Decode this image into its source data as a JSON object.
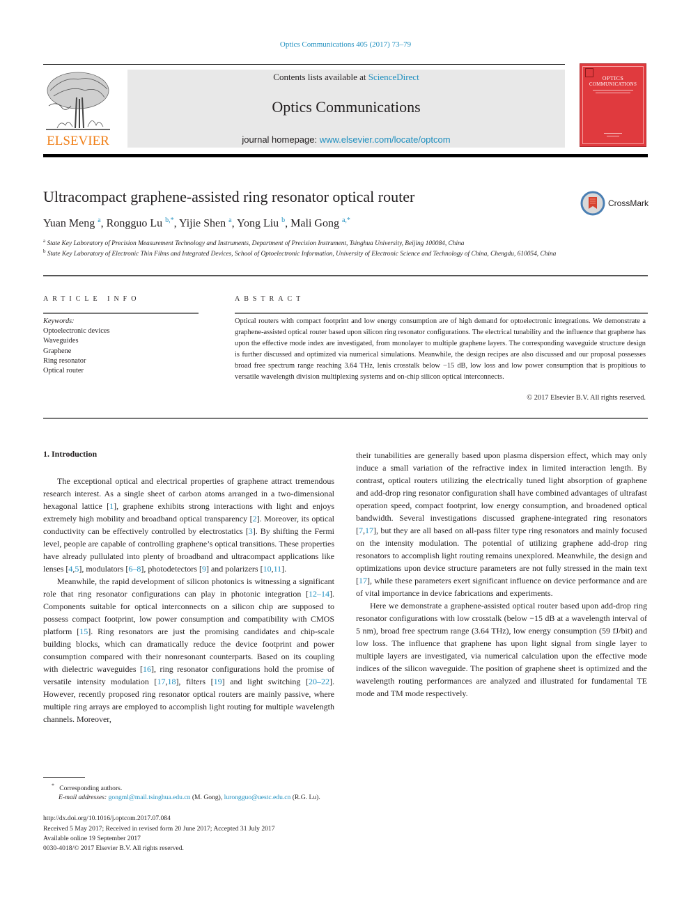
{
  "header": {
    "journal_ref": "Optics Communications 405 (2017) 73–79",
    "contents_prefix": "Contents lists available at ",
    "contents_link": "ScienceDirect",
    "journal_name": "Optics Communications",
    "homepage_prefix": "journal homepage: ",
    "homepage_link": "www.elsevier.com/locate/optcom",
    "publisher_logo_text": "ELSEVIER",
    "cover_title_line1": "OPTICS",
    "cover_title_line2": "COMMUNICATIONS"
  },
  "colors": {
    "link": "#1f8fbf",
    "elsevier_orange": "#f07f17",
    "cover_red": "#e03a3e",
    "masthead_gray": "#e8e8e8",
    "text": "#231f20"
  },
  "article": {
    "title": "Ultracompact graphene-assisted ring resonator optical router",
    "crossmark_label": "CrossMark",
    "authors": [
      {
        "name": "Yuan Meng",
        "sup": "a"
      },
      {
        "name": "Rongguo Lu",
        "sup": "b,*"
      },
      {
        "name": "Yijie Shen",
        "sup": "a"
      },
      {
        "name": "Yong Liu",
        "sup": "b"
      },
      {
        "name": "Mali Gong",
        "sup": "a,*"
      }
    ],
    "affiliations": [
      {
        "key": "a",
        "text": "State Key Laboratory of Precision Measurement Technology and Instruments, Department of Precision Instrument, Tsinghua University, Beijing 100084, China"
      },
      {
        "key": "b",
        "text": "State Key Laboratory of Electronic Thin Films and Integrated Devices, School of Optoelectronic Information, University of Electronic Science and Technology of China, Chengdu, 610054, China"
      }
    ]
  },
  "article_info": {
    "heading": "ARTICLE INFO",
    "keywords_label": "Keywords:",
    "keywords": [
      "Optoelectronic devices",
      "Waveguides",
      "Graphene",
      "Ring resonator",
      "Optical router"
    ]
  },
  "abstract": {
    "heading": "ABSTRACT",
    "text": "Optical routers with compact footprint and low energy consumption are of high demand for optoelectronic integrations. We demonstrate a graphene-assisted optical router based upon silicon ring resonator configurations. The electrical tunability and the influence that graphene has upon the effective mode index are investigated, from monolayer to multiple graphene layers. The corresponding waveguide structure design is further discussed and optimized via numerical simulations. Meanwhile, the design recipes are also discussed and our proposal possesses broad free spectrum range reaching 3.64 THz, lenis crosstalk below −15 dB, low loss and low power consumption that is propitious to versatile wavelength division multiplexing systems and on-chip silicon optical interconnects.",
    "copyright": "© 2017 Elsevier B.V. All rights reserved."
  },
  "body": {
    "section_heading": "1.  Introduction",
    "left_paragraphs": [
      [
        {
          "t": "The exceptional optical and electrical properties of graphene attract tremendous research interest. As a single sheet of carbon atoms arranged in a two-dimensional hexagonal lattice ["
        },
        {
          "c": "1"
        },
        {
          "t": "], graphene exhibits strong interactions with light and enjoys extremely high mobility and broadband optical transparency ["
        },
        {
          "c": "2"
        },
        {
          "t": "]. Moreover, its optical conductivity can be effectively controlled by electrostatics ["
        },
        {
          "c": "3"
        },
        {
          "t": "]. By shifting the Fermi level, people are capable of controlling graphene’s optical transitions. These properties have already pullulated into plenty of broadband and ultracompact applications like lenses ["
        },
        {
          "c": "4"
        },
        {
          "t": ","
        },
        {
          "c": "5"
        },
        {
          "t": "], modulators ["
        },
        {
          "c": "6–8"
        },
        {
          "t": "], photodetectors ["
        },
        {
          "c": "9"
        },
        {
          "t": "] and polarizers ["
        },
        {
          "c": "10"
        },
        {
          "t": ","
        },
        {
          "c": "11"
        },
        {
          "t": "]."
        }
      ],
      [
        {
          "t": "Meanwhile, the rapid development of silicon photonics is witnessing a significant role that ring resonator configurations can play in photonic integration ["
        },
        {
          "c": "12–14"
        },
        {
          "t": "]. Components suitable for optical interconnects on a silicon chip are supposed to possess compact footprint, low power consumption and compatibility with CMOS platform ["
        },
        {
          "c": "15"
        },
        {
          "t": "]. Ring resonators are just the promising candidates and chip-scale building blocks, which can dramatically reduce the device footprint and power consumption compared with their nonresonant counterparts. Based on its coupling with dielectric waveguides ["
        },
        {
          "c": "16"
        },
        {
          "t": "], ring resonator configurations hold the promise of versatile intensity modulation ["
        },
        {
          "c": "17"
        },
        {
          "t": ","
        },
        {
          "c": "18"
        },
        {
          "t": "], filters ["
        },
        {
          "c": "19"
        },
        {
          "t": "] and light switching ["
        },
        {
          "c": "20–22"
        },
        {
          "t": "]. However, recently proposed ring resonator optical routers are mainly passive, where multiple ring arrays are employed to accomplish light routing for multiple wavelength channels. Moreover,"
        }
      ]
    ],
    "right_paragraphs": [
      [
        {
          "t": "their tunabilities are generally based upon plasma dispersion effect, which may only induce a small variation of the refractive index in limited interaction length. By contrast, optical routers utilizing the electrically tuned light absorption of graphene and add-drop ring resonator configuration shall have combined advantages of ultrafast operation speed, compact footprint, low energy consumption, and broadened optical bandwidth. Several investigations discussed graphene-integrated ring resonators ["
        },
        {
          "c": "7"
        },
        {
          "t": ","
        },
        {
          "c": "17"
        },
        {
          "t": "], but they are all based on all-pass filter type ring resonators and mainly focused on the intensity modulation. The potential of utilizing graphene add-drop ring resonators to accomplish light routing remains unexplored. Meanwhile, the design and optimizations upon device structure parameters are not fully stressed in the main text ["
        },
        {
          "c": "17"
        },
        {
          "t": "], while these parameters exert significant influence on device performance and are of vital importance in device fabrications and experiments."
        }
      ],
      [
        {
          "t": "Here we demonstrate a graphene-assisted optical router based upon add-drop ring resonator configurations with low crosstalk (below −15 dB at a wavelength interval of 5 nm), broad free spectrum range (3.64 THz), low energy consumption (59 fJ/bit) and low loss. The influence that graphene has upon light signal from single layer to multiple layers are investigated, via numerical calculation upon the effective mode indices of the silicon waveguide. The position of graphene sheet is optimized and the wavelength routing performances are analyzed and illustrated for fundamental TE mode and TM mode respectively."
        }
      ]
    ]
  },
  "footnotes": {
    "star": "*",
    "corresponding": "Corresponding authors.",
    "email_label": "E-mail addresses: ",
    "email1": "gongml@mail.tsinghua.edu.cn",
    "email1_owner": " (M. Gong), ",
    "email2": "lurongguo@uestc.edu.cn",
    "email2_owner": " (R.G. Lu).",
    "doi": "http://dx.doi.org/10.1016/j.optcom.2017.07.084",
    "received": "Received 5 May 2017; Received in revised form 20 June 2017; Accepted 31 July 2017",
    "online": "Available online 19 September 2017",
    "issn": "0030-4018/© 2017 Elsevier B.V. All rights reserved."
  }
}
